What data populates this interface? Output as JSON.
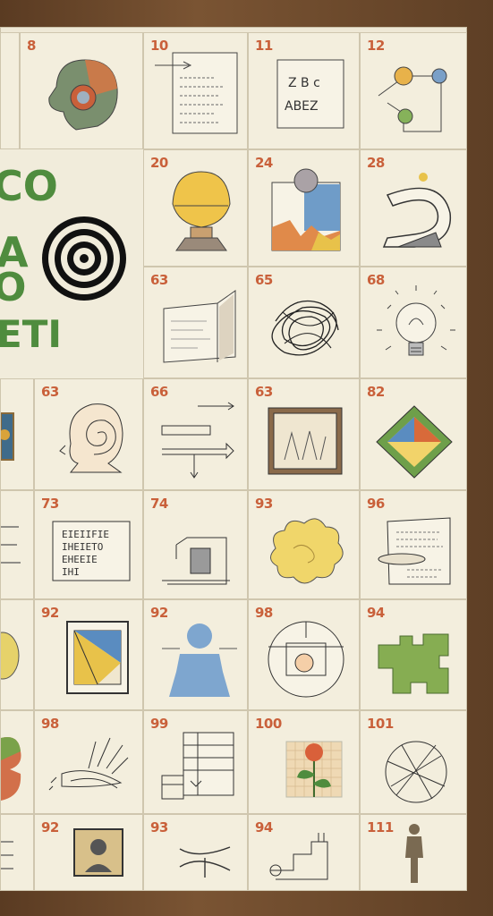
{
  "poster": {
    "title_lines": [
      "CO",
      "A",
      "O",
      "ETI"
    ]
  },
  "tiles": [
    {
      "id": "r1c1",
      "number": "8",
      "icon": "head-profile-icon"
    },
    {
      "id": "r1c2",
      "number": "10",
      "icon": "document-arrow-icon"
    },
    {
      "id": "r1c3",
      "number": "11",
      "icon": "letters-card-icon",
      "text_lines": [
        "Z B c",
        "ABEZ"
      ]
    },
    {
      "id": "r1c4",
      "number": "12",
      "icon": "circuit-circles-icon"
    },
    {
      "id": "r2c2",
      "number": "20",
      "icon": "egg-on-stand-icon"
    },
    {
      "id": "r2c3",
      "number": "24",
      "icon": "color-collage-icon"
    },
    {
      "id": "r2c4",
      "number": "28",
      "icon": "bent-pipe-icon"
    },
    {
      "id": "r3c2",
      "number": "63",
      "icon": "open-book-icon"
    },
    {
      "id": "r3c3",
      "number": "65",
      "icon": "scribble-icon"
    },
    {
      "id": "r3c4",
      "number": "68",
      "icon": "lightbulb-icon"
    },
    {
      "id": "r4c1",
      "number": "63",
      "icon": "spiral-head-icon"
    },
    {
      "id": "r4c2",
      "number": "66",
      "icon": "arrows-diagram-icon"
    },
    {
      "id": "r4c3",
      "number": "63",
      "icon": "framed-picture-icon"
    },
    {
      "id": "r4c4",
      "number": "82",
      "icon": "color-diamond-icon"
    },
    {
      "id": "r5c1",
      "number": "73",
      "icon": "text-card-icon",
      "text_lines": [
        "EIEIIFIE",
        "IHEIETO",
        "EHEEIE",
        "IHI"
      ]
    },
    {
      "id": "r5c2",
      "number": "74",
      "icon": "corner-frame-icon"
    },
    {
      "id": "r5c3",
      "number": "93",
      "icon": "yellow-cloud-icon"
    },
    {
      "id": "r5c4",
      "number": "96",
      "icon": "paper-roll-icon"
    },
    {
      "id": "r6c1",
      "number": "92",
      "icon": "framed-triangle-icon"
    },
    {
      "id": "r6c2",
      "number": "92",
      "icon": "blue-figure-icon"
    },
    {
      "id": "r6c3",
      "number": "98",
      "icon": "target-circle-icon"
    },
    {
      "id": "r6c4",
      "number": "94",
      "icon": "green-puzzle-icon"
    },
    {
      "id": "r7c1",
      "number": "98",
      "icon": "hands-sketch-icon"
    },
    {
      "id": "r7c2",
      "number": "99",
      "icon": "blueprint-icon"
    },
    {
      "id": "r7c3",
      "number": "100",
      "icon": "flower-grid-icon"
    },
    {
      "id": "r7c4",
      "number": "101",
      "icon": "crossed-circle-icon"
    },
    {
      "id": "r8c1",
      "number": "92",
      "icon": "portrait-icon"
    },
    {
      "id": "r8c2",
      "number": "93",
      "icon": "forked-lines-icon"
    },
    {
      "id": "r8c3",
      "number": "94",
      "icon": "machine-sketch-icon"
    },
    {
      "id": "r8c4",
      "number": "111",
      "icon": "standing-figure-icon"
    }
  ],
  "colors": {
    "number": "#c9603a",
    "title_green": "#4f8c3e",
    "paper": "#f3eedd",
    "frame": "#6b4a2e"
  }
}
